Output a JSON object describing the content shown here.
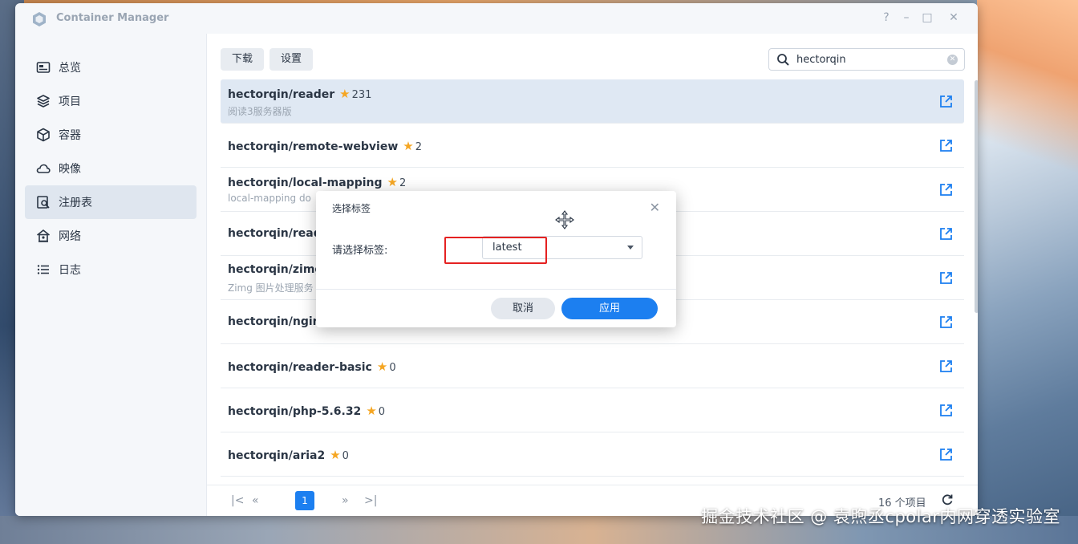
{
  "window": {
    "title": "Container Manager",
    "controls": [
      "?",
      "–",
      "□",
      "✕"
    ]
  },
  "sidebar": {
    "items": [
      {
        "label": "总览",
        "icon": "overview-icon"
      },
      {
        "label": "项目",
        "icon": "project-icon"
      },
      {
        "label": "容器",
        "icon": "container-icon"
      },
      {
        "label": "映像",
        "icon": "image-icon"
      },
      {
        "label": "注册表",
        "icon": "registry-icon",
        "active": true
      },
      {
        "label": "网络",
        "icon": "network-icon"
      },
      {
        "label": "日志",
        "icon": "log-icon"
      }
    ]
  },
  "toolbar": {
    "download_label": "下载",
    "settings_label": "设置"
  },
  "search": {
    "value": "hectorqin"
  },
  "list": {
    "rows": [
      {
        "name": "hectorqin/reader",
        "stars": "231",
        "desc": "阅读3服务器版"
      },
      {
        "name": "hectorqin/remote-webview",
        "stars": "2",
        "desc": ""
      },
      {
        "name": "hectorqin/local-mapping",
        "stars": "2",
        "desc": "local-mapping do"
      },
      {
        "name": "hectorqin/read",
        "stars": "",
        "desc": ""
      },
      {
        "name": "hectorqin/zimg",
        "stars": "",
        "desc": "Zimg 图片处理服务"
      },
      {
        "name": "hectorqin/ngin",
        "stars": "",
        "desc": ""
      },
      {
        "name": "hectorqin/reader-basic",
        "stars": "0",
        "desc": ""
      },
      {
        "name": "hectorqin/php-5.6.32",
        "stars": "0",
        "desc": ""
      },
      {
        "name": "hectorqin/aria2",
        "stars": "0",
        "desc": ""
      }
    ]
  },
  "pager": {
    "current_page": "1",
    "total_text": "16 个项目"
  },
  "modal": {
    "title": "选择标签",
    "label": "请选择标签:",
    "selected_tag": "latest",
    "cancel_label": "取消",
    "apply_label": "应用"
  },
  "watermark": "掘金技术社区 @ 袁煦丞cpolar内网穿透实验室",
  "colors": {
    "accent": "#1c7ff0",
    "star": "#f5a623",
    "highlight_border": "#e52121"
  }
}
